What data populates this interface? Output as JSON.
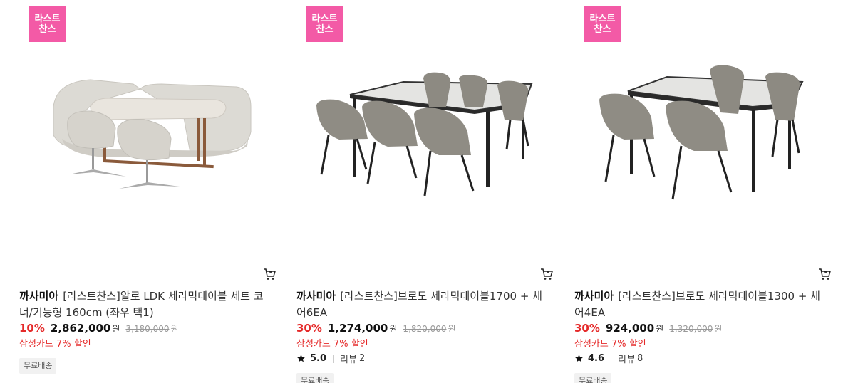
{
  "products": [
    {
      "badge_line1": "라스트",
      "badge_line2": "찬스",
      "brand": "까사미아",
      "name": "[라스트찬스]알로 LDK 세라믹테이블 세트 코너/기능형 160cm (좌우 택1)",
      "discount": "10%",
      "price": "2,862,000",
      "currency": "원",
      "original_price": "3,180,000",
      "card_promo": "삼성카드 7% 할인",
      "rating": "",
      "review_label": "",
      "review_count": "",
      "shipping": "무료배송",
      "image_icon": "sofa-dining-set-image",
      "cart_icon": "cart-icon"
    },
    {
      "badge_line1": "라스트",
      "badge_line2": "찬스",
      "brand": "까사미아",
      "name": "[라스트찬스]브로도 세라믹테이블1700 + 체어6EA",
      "discount": "30%",
      "price": "1,274,000",
      "currency": "원",
      "original_price": "1,820,000",
      "card_promo": "삼성카드 7% 할인",
      "rating": "5.0",
      "review_label": "리뷰",
      "review_count": "2",
      "shipping": "무료배송",
      "image_icon": "dining-table-6-chairs-image",
      "cart_icon": "cart-icon"
    },
    {
      "badge_line1": "라스트",
      "badge_line2": "찬스",
      "brand": "까사미아",
      "name": "[라스트찬스]브로도 세라믹테이블1300 + 체어4EA",
      "discount": "30%",
      "price": "924,000",
      "currency": "원",
      "original_price": "1,320,000",
      "card_promo": "삼성카드 7% 할인",
      "rating": "4.6",
      "review_label": "리뷰",
      "review_count": "8",
      "shipping": "무료배송",
      "image_icon": "dining-table-4-chairs-image",
      "cart_icon": "cart-icon"
    }
  ],
  "colors": {
    "badge": "#f35aa6",
    "discount": "#e52a2a",
    "muted": "#999999",
    "tag_bg": "#f1f1f1"
  }
}
